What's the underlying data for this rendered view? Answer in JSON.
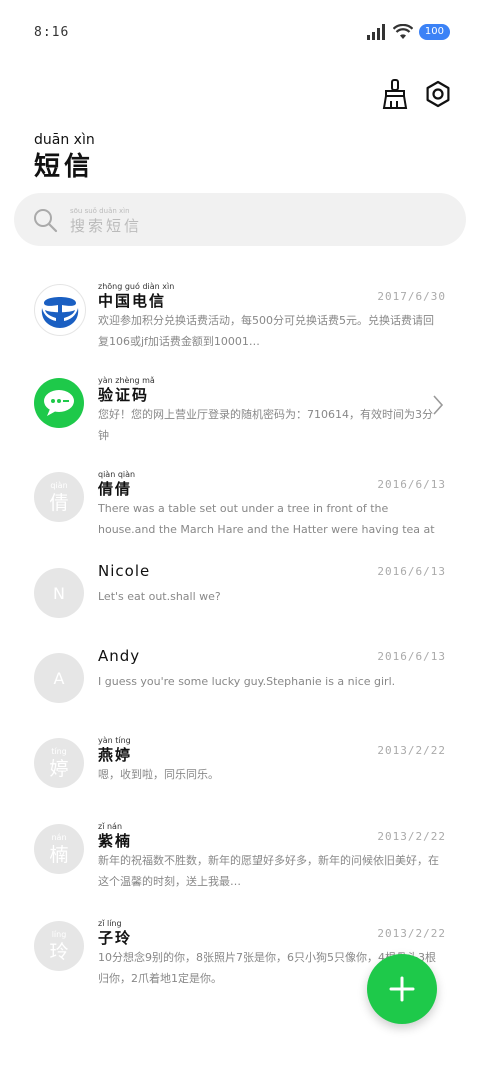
{
  "status": {
    "time": "8:16",
    "battery": "100"
  },
  "header": {
    "title_pinyin": "duān xìn",
    "title": "短信"
  },
  "search": {
    "pinyin": "sōu suǒ duǎn xìn",
    "placeholder": "搜索短信"
  },
  "conversations": [
    {
      "avatar_text": "",
      "avatar_small": "",
      "name_pinyin": "zhōng guó diàn xìn",
      "name": "中国电信",
      "date": "2017/6/30",
      "message": "欢迎参加积分兑换话费活动，每500分可兑换话费5元。兑换话费请回复106或jf加话费金额到10001…"
    },
    {
      "avatar_text": "",
      "avatar_small": "",
      "name_pinyin": "yàn zhèng mǎ",
      "name": "验证码",
      "date": "",
      "message": "您好！您的网上营业厅登录的随机密码为：710614，有效时间为3分钟"
    },
    {
      "avatar_text": "倩",
      "avatar_small": "qiàn",
      "name_pinyin": "qiàn qiàn",
      "name": "倩倩",
      "date": "2016/6/13",
      "message": "There was a table set out under a tree in front of the house.and the March Hare and the Hatter were having tea at it."
    },
    {
      "avatar_text": "N",
      "avatar_small": "",
      "name_pinyin": "",
      "name": "Nicole",
      "date": "2016/6/13",
      "message": "Let's eat out.shall we?"
    },
    {
      "avatar_text": "A",
      "avatar_small": "",
      "name_pinyin": "",
      "name": "Andy",
      "date": "2016/6/13",
      "message": "I guess you're some lucky guy.Stephanie is a nice girl."
    },
    {
      "avatar_text": "婷",
      "avatar_small": "tíng",
      "name_pinyin": "yàn tíng",
      "name": "燕婷",
      "date": "2013/2/22",
      "message": "嗯，收到啦，同乐同乐。"
    },
    {
      "avatar_text": "楠",
      "avatar_small": "nán",
      "name_pinyin": "zǐ nán",
      "name": "紫楠",
      "date": "2013/2/22",
      "message": "新年的祝福数不胜数，新年的愿望好多好多，新年的问候依旧美好，在这个温馨的时刻，送上我最…"
    },
    {
      "avatar_text": "玲",
      "avatar_small": "líng",
      "name_pinyin": "zǐ líng",
      "name": "子玲",
      "date": "2013/2/22",
      "message": "10分想念9别的你，8张照片7张是你，6只小狗5只像你，4根骨头3根归你，2爪着地1定是你。"
    }
  ],
  "colors": {
    "accent": "#1ec94a",
    "telecom": "#1a5fc2",
    "avatar_bg": "#e6e6e6"
  }
}
